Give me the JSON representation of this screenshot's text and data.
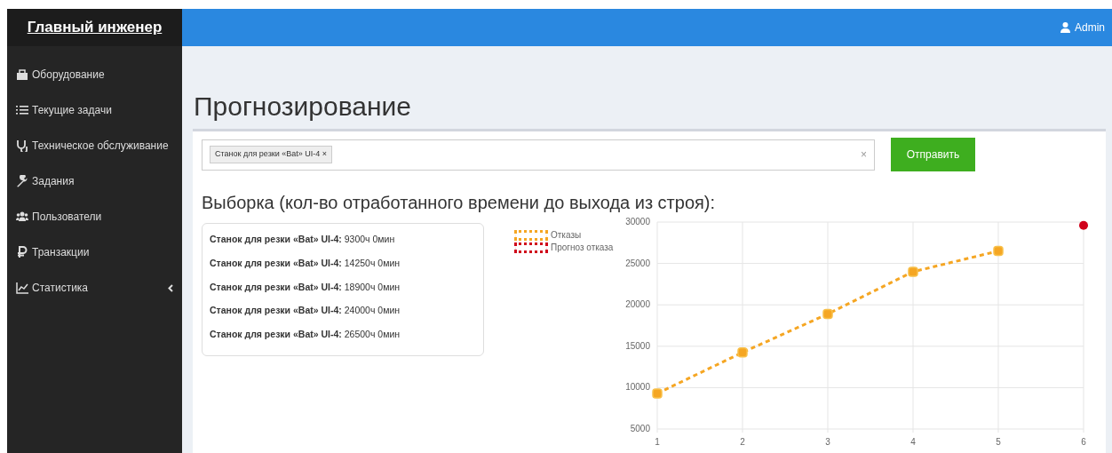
{
  "sidebar": {
    "title": "Главный инженер",
    "items": [
      {
        "label": "Оборудование",
        "expandable": false
      },
      {
        "label": "Текущие задачи",
        "expandable": false
      },
      {
        "label": "Техническое обслуживание",
        "expandable": false
      },
      {
        "label": "Задания",
        "expandable": false
      },
      {
        "label": "Пользователи",
        "expandable": false
      },
      {
        "label": "Транзакции",
        "expandable": false
      },
      {
        "label": "Статистика",
        "expandable": true
      }
    ]
  },
  "header": {
    "user": "Admin"
  },
  "page_title": "Прогнозирование",
  "select": {
    "tags": [
      {
        "label": "Станок для резки «Bat» UI-4",
        "remove": "×"
      }
    ],
    "clear": "×"
  },
  "submit_button": "Отправить",
  "sample_title": "Выборка (кол-во отработанного времени до выхода из строя):",
  "samples": [
    {
      "name": "Станок для резки «Bat» UI-4:",
      "value": "9300ч 0мин"
    },
    {
      "name": "Станок для резки «Bat» UI-4:",
      "value": "14250ч 0мин"
    },
    {
      "name": "Станок для резки «Bat» UI-4:",
      "value": "18900ч 0мин"
    },
    {
      "name": "Станок для резки «Bat» UI-4:",
      "value": "24000ч 0мин"
    },
    {
      "name": "Станок для резки «Bat» UI-4:",
      "value": "26500ч 0мин"
    }
  ],
  "chart": {
    "chart_data": {
      "type": "line",
      "grid": true,
      "x": [
        1,
        2,
        3,
        4,
        5,
        6
      ],
      "xlim": [
        1,
        6
      ],
      "xticks": [
        1,
        2,
        3,
        4,
        5,
        6
      ],
      "ylim": [
        5000,
        30000
      ],
      "yticks": [
        5000,
        10000,
        15000,
        20000,
        25000,
        30000
      ],
      "series": [
        {
          "name": "Отказы",
          "color": "#f5a623",
          "line_style": "dashed",
          "marker": "square",
          "values": [
            9300,
            14250,
            18900,
            24000,
            26500,
            null
          ]
        },
        {
          "name": "Прогноз отказа",
          "color": "#d0021b",
          "line_style": "dashed",
          "marker": "circle",
          "values": [
            null,
            null,
            null,
            null,
            null,
            29600
          ]
        }
      ]
    }
  }
}
